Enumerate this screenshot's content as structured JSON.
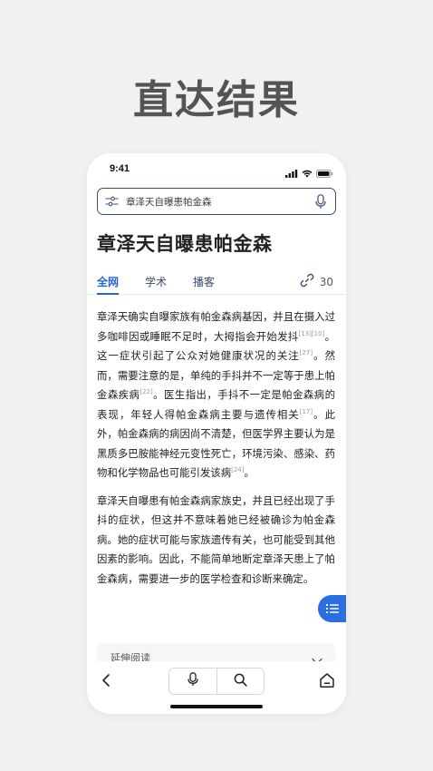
{
  "hero": {
    "title": "直达结果"
  },
  "status_bar": {
    "time": "9:41"
  },
  "search": {
    "query": "章泽天自曝患帕金森"
  },
  "page": {
    "title": "章泽天自曝患帕金森"
  },
  "tabs": [
    {
      "label": "全网",
      "active": true
    },
    {
      "label": "学术",
      "active": false
    },
    {
      "label": "播客",
      "active": false
    }
  ],
  "link_count": "30",
  "paragraph1": {
    "s1": "章泽天确实自曝家族有帕金森病基因，并且在摄入过多咖啡因或睡眠不足时，大拇指会开始发抖",
    "r1": "[13][10]",
    "s2": "。这一症状引起了公众对她健康状况的关注",
    "r2": "[27]",
    "s3": "。然而，需要注意的是，单纯的手抖并不一定等于患上帕金森疾病",
    "r3": "[22]",
    "s4": "。医生指出，手抖不一定是帕金森病的表现，年轻人得帕金森病主要与遗传相关",
    "r4": "[17]",
    "s5": "。此外，帕金森病的病因尚不清楚，但医学界主要认为是黑质多巴胺能神经元变性死亡，环境污染、感染、药物和化学物品也可能引发该病",
    "r5": "[24]",
    "s6": "。"
  },
  "paragraph2": "章泽天自曝患有帕金森病家族史，并且已经出现了手抖的症状，但这并不意味着她已经被确诊为帕金森病。她的症状可能与家族遗传有关，也可能受到其他因素的影响。因此，不能简单地断定章泽天患上了帕金森病，需要进一步的医学检查和诊断来确定。",
  "further_reading": {
    "label": "延伸阅读"
  },
  "colors": {
    "accent": "#2565d8",
    "fab": "#2a6ee0",
    "hero_text": "#545454",
    "background": "#f2f1f2"
  },
  "icons": [
    "filter-icon",
    "mic-icon",
    "link-icon",
    "toc-list-icon",
    "chevron-down-icon",
    "back-chevron-icon",
    "search-icon",
    "home-icon",
    "signal-icon",
    "wifi-icon",
    "battery-icon"
  ]
}
